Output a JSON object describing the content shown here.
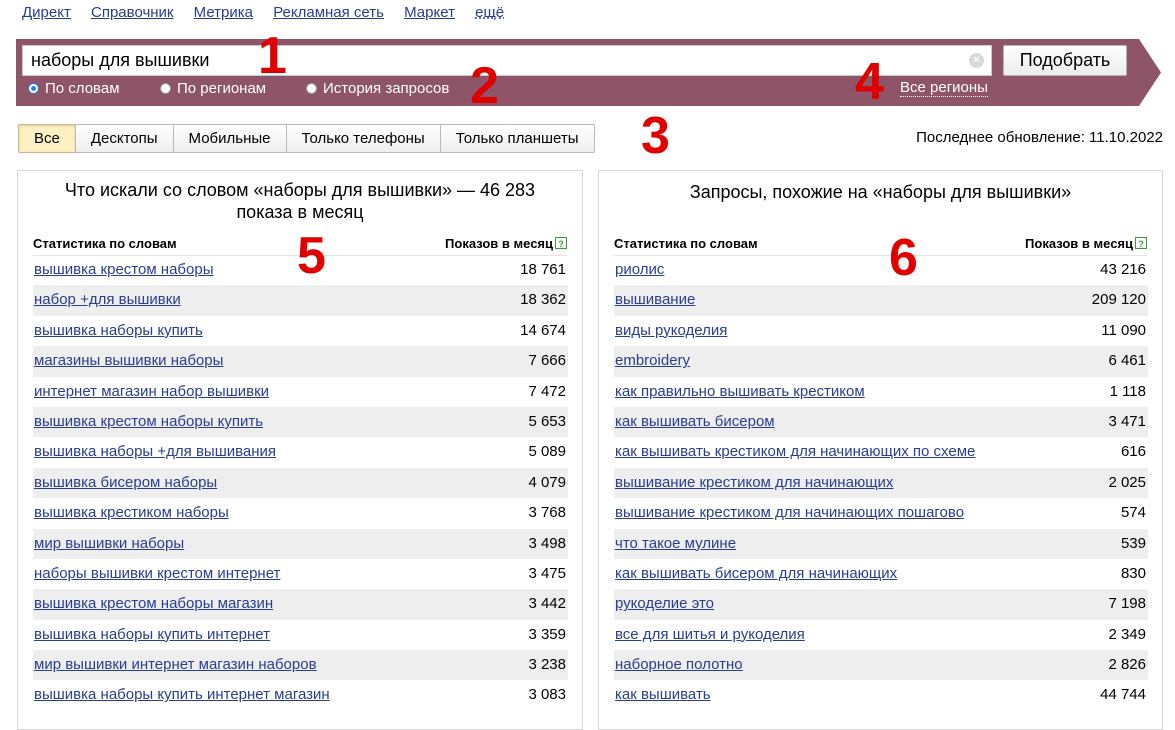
{
  "topnav": [
    "Директ",
    "Справочник",
    "Метрика",
    "Рекламная сеть",
    "Маркет",
    "ещё"
  ],
  "search": {
    "value": "наборы для вышивки",
    "clear_glyph": "×",
    "submit_label": "Подобрать"
  },
  "radios": [
    "По словам",
    "По регионам",
    "История запросов"
  ],
  "regions_link": "Все регионы",
  "tabs": [
    "Все",
    "Десктопы",
    "Мобильные",
    "Только телефоны",
    "Только планшеты"
  ],
  "updated": "Последнее обновление: 11.10.2022",
  "annotations": [
    "1",
    "2",
    "3",
    "4",
    "5",
    "6"
  ],
  "left_panel": {
    "title": "Что искали со словом «наборы для вышивки» — 46 283 показа в месяц",
    "col_words": "Статистика по словам",
    "col_count": "Показов в месяц",
    "rows": [
      {
        "kw": "вышивка крестом наборы",
        "n": "18 761"
      },
      {
        "kw": "набор +для вышивки",
        "n": "18 362"
      },
      {
        "kw": "вышивка наборы купить",
        "n": "14 674"
      },
      {
        "kw": "магазины вышивки наборы",
        "n": "7 666"
      },
      {
        "kw": "интернет магазин набор вышивки",
        "n": "7 472"
      },
      {
        "kw": "вышивка крестом наборы купить",
        "n": "5 653"
      },
      {
        "kw": "вышивка наборы +для вышивания",
        "n": "5 089"
      },
      {
        "kw": "вышивка бисером наборы",
        "n": "4 079"
      },
      {
        "kw": "вышивка крестиком наборы",
        "n": "3 768"
      },
      {
        "kw": "мир вышивки наборы",
        "n": "3 498"
      },
      {
        "kw": "наборы вышивки крестом интернет",
        "n": "3 475"
      },
      {
        "kw": "вышивка крестом наборы магазин",
        "n": "3 442"
      },
      {
        "kw": "вышивка наборы купить интернет",
        "n": "3 359"
      },
      {
        "kw": "мир вышивки интернет магазин наборов",
        "n": "3 238"
      },
      {
        "kw": "вышивка наборы купить интернет магазин",
        "n": "3 083"
      }
    ]
  },
  "right_panel": {
    "title": "Запросы, похожие на «наборы для вышивки»",
    "col_words": "Статистика по словам",
    "col_count": "Показов в месяц",
    "rows": [
      {
        "kw": "риолис",
        "n": "43 216"
      },
      {
        "kw": "вышивание",
        "n": "209 120"
      },
      {
        "kw": "виды рукоделия",
        "n": "11 090"
      },
      {
        "kw": "embroidery",
        "n": "6 461"
      },
      {
        "kw": "как правильно вышивать крестиком",
        "n": "1 118"
      },
      {
        "kw": "как вышивать бисером",
        "n": "3 471"
      },
      {
        "kw": "как вышивать крестиком для начинающих по схеме",
        "n": "616"
      },
      {
        "kw": "вышивание крестиком для начинающих",
        "n": "2 025"
      },
      {
        "kw": "вышивание крестиком для начинающих пошагово",
        "n": "574"
      },
      {
        "kw": "что такое мулине",
        "n": "539"
      },
      {
        "kw": "как вышивать бисером для начинающих",
        "n": "830"
      },
      {
        "kw": "рукоделие это",
        "n": "7 198"
      },
      {
        "kw": "все для шитья и рукоделия",
        "n": "2 349"
      },
      {
        "kw": "наборное полотно",
        "n": "2 826"
      },
      {
        "kw": "как вышивать",
        "n": "44 744"
      }
    ]
  }
}
